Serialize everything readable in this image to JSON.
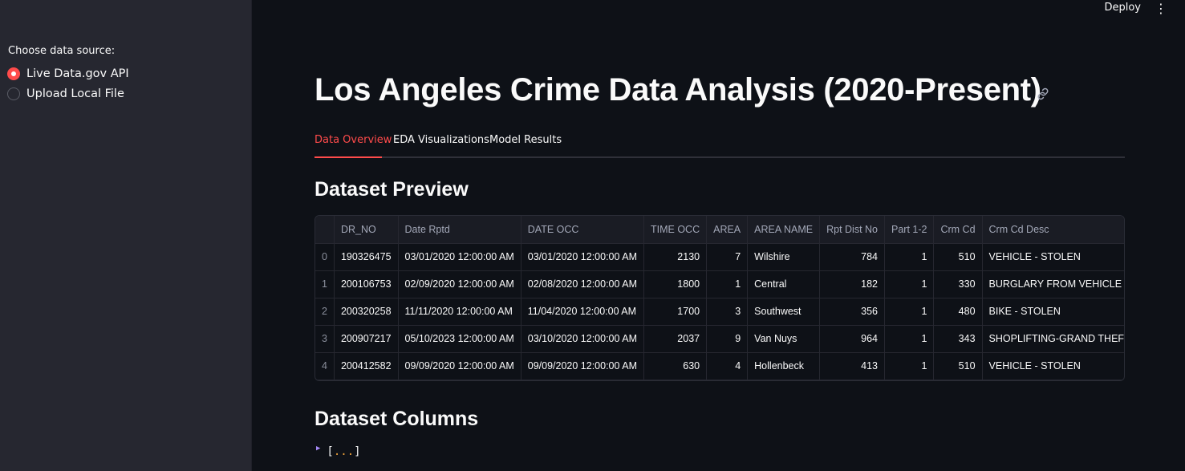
{
  "sidebar": {
    "radio_label": "Choose data source:",
    "options": [
      {
        "label": "Live Data.gov API",
        "selected": true
      },
      {
        "label": "Upload Local File",
        "selected": false
      }
    ]
  },
  "topbar": {
    "deploy_label": "Deploy",
    "menu_icon": "vertical-ellipsis-icon"
  },
  "main": {
    "title": "Los Angeles Crime Data Analysis (2020-Present)",
    "title_icon": "link-icon",
    "tabs": [
      {
        "label": "Data Overview",
        "active": true
      },
      {
        "label": "EDA Visualizations",
        "active": false
      },
      {
        "label": "Model Results",
        "active": false
      }
    ],
    "preview_heading": "Dataset Preview",
    "columns_heading": "Dataset Columns",
    "columns_expander": {
      "open": "[",
      "dots": "...",
      "close": "]"
    }
  },
  "table": {
    "headers": [
      "",
      "DR_NO",
      "Date Rptd",
      "DATE OCC",
      "TIME OCC",
      "AREA",
      "AREA NAME",
      "Rpt Dist No",
      "Part 1-2",
      "Crm Cd",
      "Crm Cd Desc"
    ],
    "rows": [
      [
        "0",
        "190326475",
        "03/01/2020 12:00:00 AM",
        "03/01/2020 12:00:00 AM",
        "2130",
        "7",
        "Wilshire",
        "784",
        "1",
        "510",
        "VEHICLE - STOLEN"
      ],
      [
        "1",
        "200106753",
        "02/09/2020 12:00:00 AM",
        "02/08/2020 12:00:00 AM",
        "1800",
        "1",
        "Central",
        "182",
        "1",
        "330",
        "BURGLARY FROM VEHICLE"
      ],
      [
        "2",
        "200320258",
        "11/11/2020 12:00:00 AM",
        "11/04/2020 12:00:00 AM",
        "1700",
        "3",
        "Southwest",
        "356",
        "1",
        "480",
        "BIKE - STOLEN"
      ],
      [
        "3",
        "200907217",
        "05/10/2023 12:00:00 AM",
        "03/10/2020 12:00:00 AM",
        "2037",
        "9",
        "Van Nuys",
        "964",
        "1",
        "343",
        "SHOPLIFTING-GRAND THEFT ($"
      ],
      [
        "4",
        "200412582",
        "09/09/2020 12:00:00 AM",
        "09/09/2020 12:00:00 AM",
        "630",
        "4",
        "Hollenbeck",
        "413",
        "1",
        "510",
        "VEHICLE - STOLEN"
      ]
    ]
  },
  "colors": {
    "accent": "#ff4b4b",
    "background": "#0e1117",
    "sidebar": "#262730"
  }
}
